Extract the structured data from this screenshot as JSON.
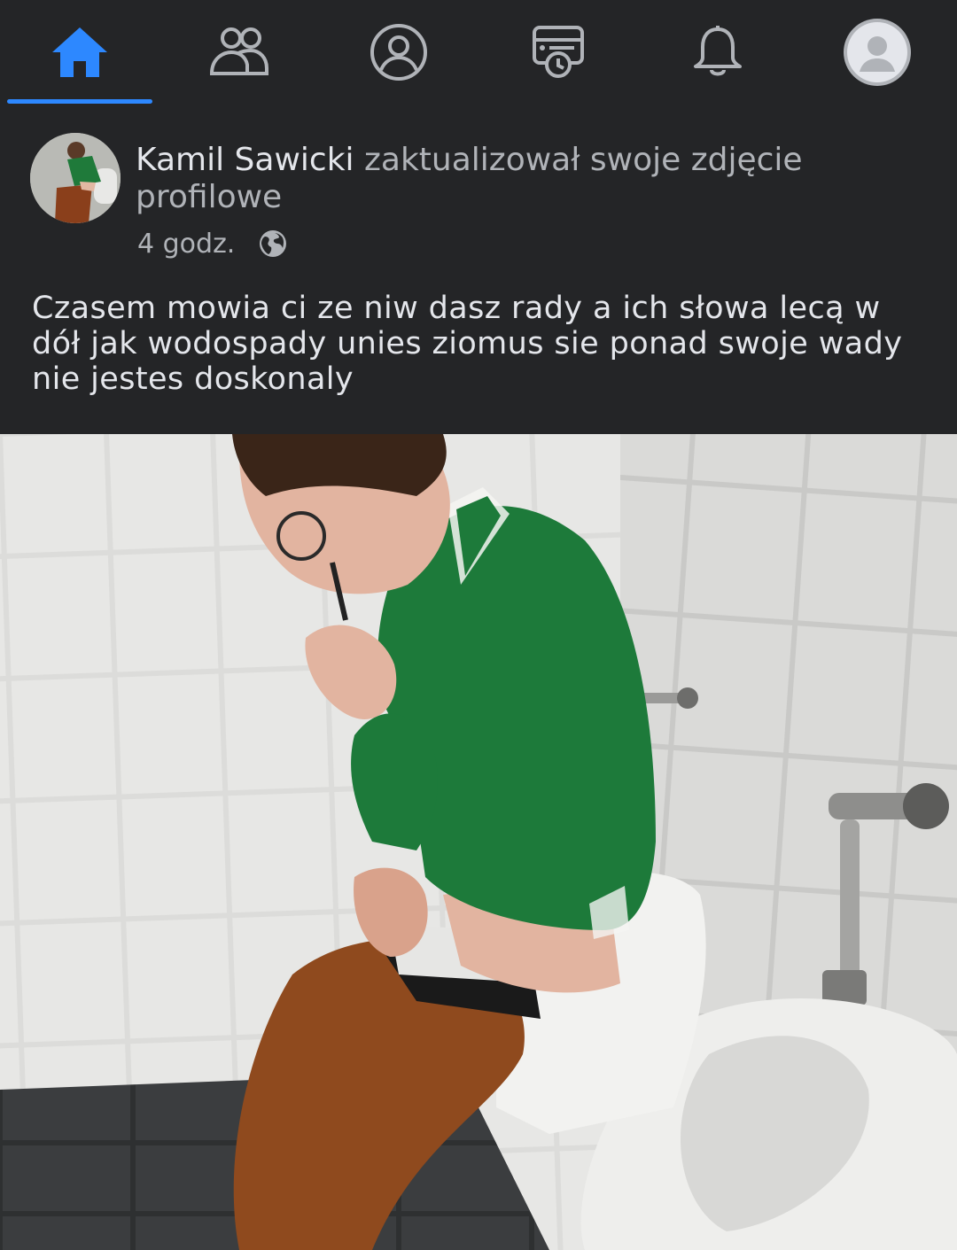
{
  "nav": {
    "active_color": "#2d88ff",
    "icon_color": "#b0b3b8",
    "items": [
      {
        "icon": "home-icon",
        "active": true
      },
      {
        "icon": "friends-icon",
        "active": false
      },
      {
        "icon": "profile-icon",
        "active": false
      },
      {
        "icon": "news-feed-icon",
        "active": false
      },
      {
        "icon": "bell-icon",
        "active": false
      },
      {
        "icon": "avatar-icon",
        "active": false
      }
    ]
  },
  "post": {
    "author": "Kamil Sawicki",
    "action": " zaktualizował swoje zdjęcie profilowe",
    "time": "4 godz.",
    "privacy_icon": "globe-icon",
    "text": "Czasem mowia ci ze niw dasz rady a ich słowa lecą w dół jak wodospady unies ziomus sie ponad swoje wady nie jestes doskonaly"
  },
  "colors": {
    "background": "#242527",
    "text_primary": "#e4e6eb",
    "text_secondary": "#b0b3b8",
    "accent": "#2d88ff"
  }
}
